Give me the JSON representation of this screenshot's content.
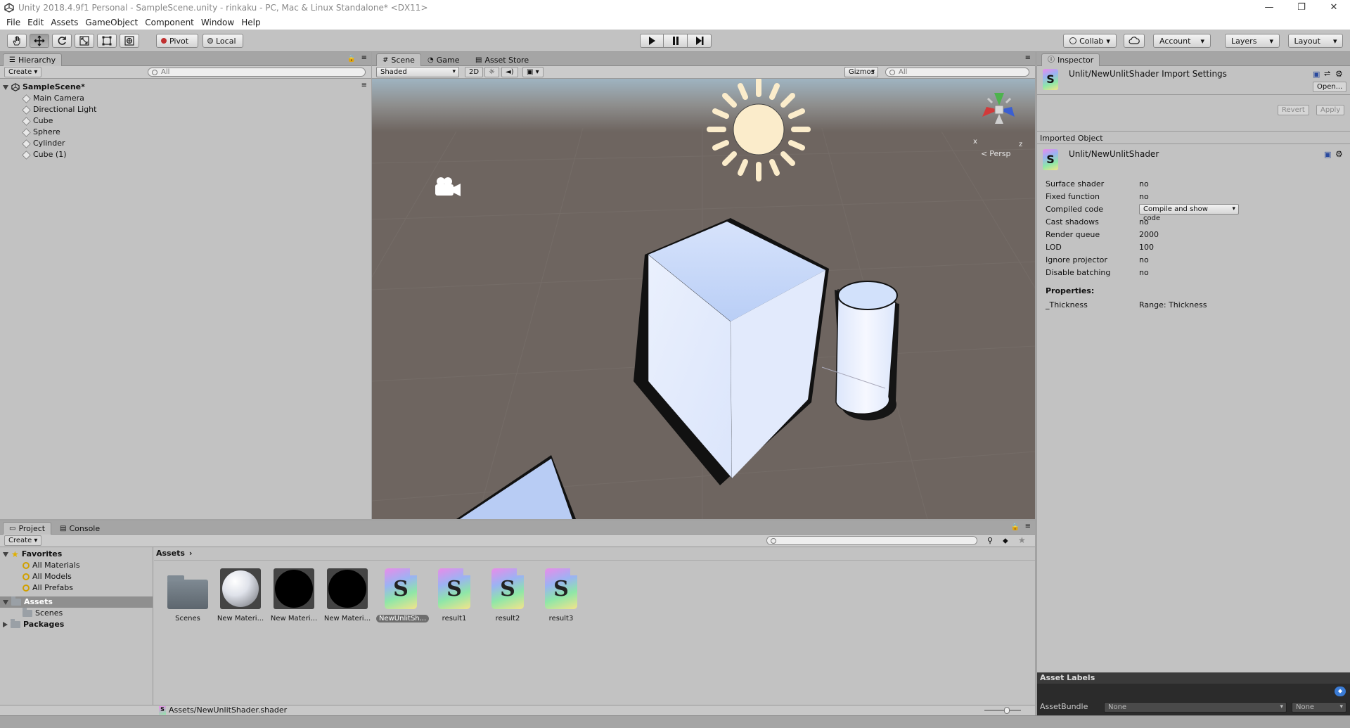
{
  "window": {
    "title": "Unity 2018.4.9f1 Personal - SampleScene.unity - rinkaku - PC, Mac & Linux Standalone* <DX11>",
    "controls": {
      "minimize": "—",
      "restore": "❐",
      "close": "✕"
    }
  },
  "menu": [
    "File",
    "Edit",
    "Assets",
    "GameObject",
    "Component",
    "Window",
    "Help"
  ],
  "toolbar": {
    "pivot_label": "Pivot",
    "local_label": "Local",
    "collab_label": "Collab",
    "account_label": "Account",
    "layers_label": "Layers",
    "layout_label": "Layout"
  },
  "hierarchy": {
    "tab_label": "Hierarchy",
    "create_label": "Create",
    "search_placeholder": "All",
    "scene_name": "SampleScene*",
    "items": [
      "Main Camera",
      "Directional Light",
      "Cube",
      "Sphere",
      "Cylinder",
      "Cube (1)"
    ]
  },
  "scene_view": {
    "tabs": [
      "Scene",
      "Game",
      "Asset Store"
    ],
    "shading_mode": "Shaded",
    "mode_2d": "2D",
    "gizmos_label": "Gizmos",
    "search_placeholder": "All",
    "persp_label": "Persp",
    "axis_x": "x",
    "axis_z": "z",
    "bg_color": "#6e6560",
    "sky_color": "#a9b2b8"
  },
  "inspector": {
    "tab_label": "Inspector",
    "header_title": "Unlit/NewUnlitShader Import Settings",
    "open_label": "Open...",
    "revert_label": "Revert",
    "apply_label": "Apply",
    "imported_object_label": "Imported Object",
    "object_name": "Unlit/NewUnlitShader",
    "fields": [
      {
        "label": "Surface shader",
        "value": "no"
      },
      {
        "label": "Fixed function",
        "value": "no"
      },
      {
        "label": "Compiled code",
        "value": "Compile and show code"
      },
      {
        "label": "Cast shadows",
        "value": "no"
      },
      {
        "label": "Render queue",
        "value": "2000"
      },
      {
        "label": "LOD",
        "value": "100"
      },
      {
        "label": "Ignore projector",
        "value": "no"
      },
      {
        "label": "Disable batching",
        "value": "no"
      }
    ],
    "properties_label": "Properties:",
    "properties": [
      {
        "label": "_Thickness",
        "value": "Range: Thickness"
      }
    ],
    "asset_labels_title": "Asset Labels",
    "asset_bundle_label": "AssetBundle",
    "asset_bundle_value": "None",
    "asset_bundle_variant": "None"
  },
  "project": {
    "tabs": [
      "Project",
      "Console"
    ],
    "create_label": "Create",
    "favorites_label": "Favorites",
    "favorites": [
      "All Materials",
      "All Models",
      "All Prefabs"
    ],
    "assets_label": "Assets",
    "assets_children": [
      "Scenes"
    ],
    "packages_label": "Packages",
    "breadcrumb": "Assets",
    "items": [
      {
        "name": "Scenes",
        "kind": "folder"
      },
      {
        "name": "New Materi...",
        "kind": "material-white"
      },
      {
        "name": "New Materi...",
        "kind": "material-black"
      },
      {
        "name": "New Materi...",
        "kind": "material-black"
      },
      {
        "name": "NewUnlitSh...",
        "kind": "shader",
        "selected": true
      },
      {
        "name": "result1",
        "kind": "shader"
      },
      {
        "name": "result2",
        "kind": "shader"
      },
      {
        "name": "result3",
        "kind": "shader"
      }
    ],
    "status_path": "Assets/NewUnlitShader.shader"
  }
}
